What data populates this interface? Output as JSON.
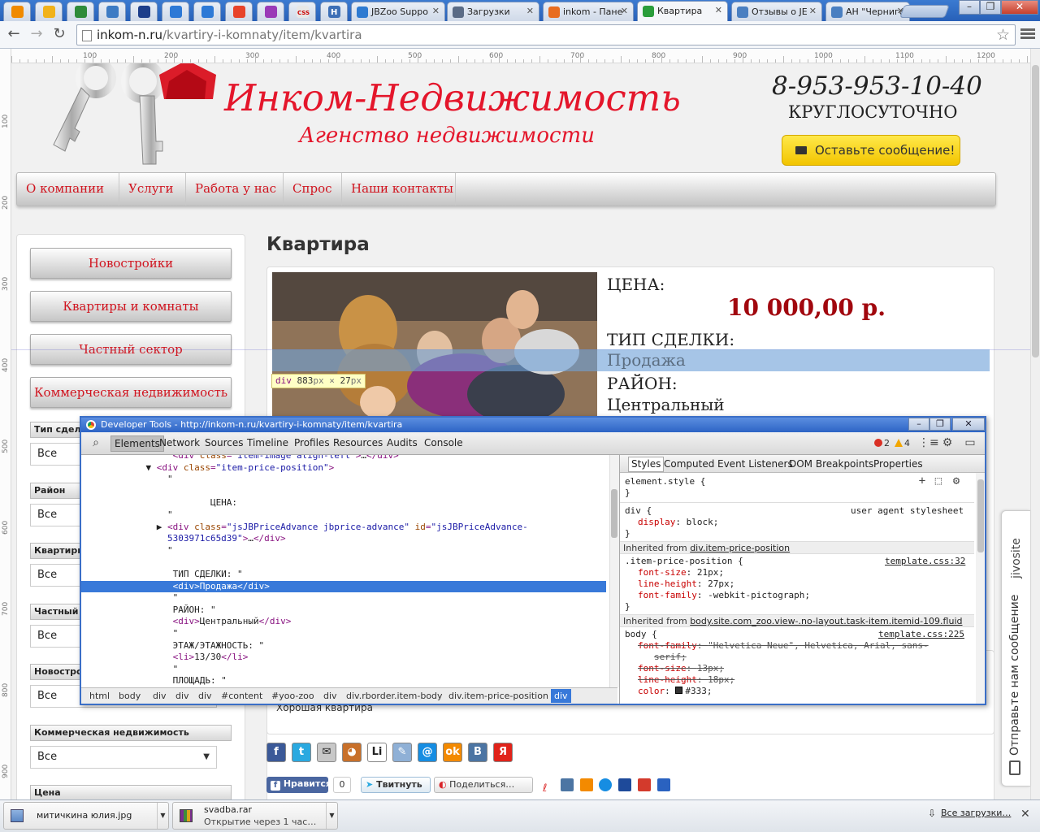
{
  "browser": {
    "tabs": [
      {
        "label": "JBZoo Suppo",
        "icon_color": "#2e7ad1"
      },
      {
        "label": "Загрузки",
        "icon_color": "#5a6b86"
      },
      {
        "label": "inkom - Пане",
        "icon_color": "#e86c1f"
      },
      {
        "label": "Квартира",
        "icon_color": "#2a9d3a"
      },
      {
        "label": "Отзывы о JE",
        "icon_color": "#4a7fc1"
      },
      {
        "label": "АН \"Черниго",
        "icon_color": "#4a7fc1"
      }
    ],
    "pinned_tabs": [
      {
        "icon": "mail-ru-icon",
        "color": "#f08a00"
      },
      {
        "icon": "dollar-icon",
        "color": "#f1b21a"
      },
      {
        "icon": "excel-icon",
        "color": "#2e8b3a"
      },
      {
        "icon": "z-icon",
        "color": "#3d7bc4"
      },
      {
        "icon": "dark-blue-icon",
        "color": "#1d3e8a"
      },
      {
        "icon": "disc-icon",
        "color": "#2d79d6"
      },
      {
        "icon": "disc-icon",
        "color": "#2d79d6"
      },
      {
        "icon": "color-wheel-icon",
        "color": "#e8432a"
      },
      {
        "icon": "flower-icon",
        "color": "#9a3ab7"
      },
      {
        "icon": "css-profi-icon",
        "color": "#e7e7e7"
      },
      {
        "icon": "h-icon",
        "color": "#3d6fb6"
      }
    ],
    "css_profi_label": "CSS",
    "h_label": "H",
    "url_host": "inkom-n.ru",
    "url_path": "/kvartiry-i-komnaty/item/kvartira",
    "window_buttons": [
      "–",
      "❐",
      "✕"
    ]
  },
  "rulers": {
    "horizontal": [
      "100",
      "200",
      "300",
      "400",
      "500",
      "600",
      "700",
      "800",
      "900",
      "1000",
      "1100",
      "1200"
    ],
    "vertical": [
      "100",
      "200",
      "300",
      "400",
      "500",
      "600",
      "700",
      "800",
      "900"
    ]
  },
  "site": {
    "title": "Инком-Недвижимость",
    "subtitle": "Агенство недвижимости",
    "phone": "8-953-953-10-40",
    "hours": "КРУГЛОСУТОЧНО",
    "message_button": "Оставьте сообщение!",
    "nav": [
      "О компании",
      "Услуги",
      "Работа у нас",
      "Спрос",
      "Наши контакты"
    ],
    "sidebar_buttons": [
      "Новостройки",
      "Квартиры и комнаты",
      "Частный сектор",
      "Коммерческая недвижимость"
    ],
    "filters": [
      {
        "label": "Тип сделки",
        "value": "Все"
      },
      {
        "label": "Район",
        "value": "Все"
      },
      {
        "label": "Квартиры",
        "value": "Все"
      },
      {
        "label": "Частный с",
        "value": "Все"
      },
      {
        "label": "Новострои",
        "value": "Все"
      },
      {
        "label": "Коммерческая недвижимость",
        "value": "Все"
      },
      {
        "label": "Цена",
        "value": ""
      }
    ],
    "page_heading": "Квартира",
    "price_label": "ЦЕНА:",
    "price_value": "10 000,00 р.",
    "deal_label": "ТИП СДЕЛКИ:",
    "deal_value": "Продажа",
    "district_label": "РАЙОН:",
    "district_value": "Центральный",
    "description": "Хорошая квартира",
    "share_icons": [
      {
        "name": "facebook-share-icon",
        "color": "#3b5998",
        "glyph": "f"
      },
      {
        "name": "twitter-share-icon",
        "color": "#2aa9e0",
        "glyph": "t"
      },
      {
        "name": "email-share-icon",
        "color": "#c8c8c8",
        "glyph": "✉"
      },
      {
        "name": "dog-share-icon",
        "color": "#c8702a",
        "glyph": "◕"
      },
      {
        "name": "liveinternet-share-icon",
        "color": "#ffffff",
        "glyph": "Li"
      },
      {
        "name": "pencil-share-icon",
        "color": "#8fb0d6",
        "glyph": "✎"
      },
      {
        "name": "mailru-share-icon",
        "color": "#168de2",
        "glyph": "@"
      },
      {
        "name": "odnoklassniki-share-icon",
        "color": "#f38a00",
        "glyph": "ok"
      },
      {
        "name": "vkontakte-share-icon",
        "color": "#4c75a3",
        "glyph": "B"
      },
      {
        "name": "yandex-share-icon",
        "color": "#e0231a",
        "glyph": "Я"
      }
    ],
    "like_label": "Нравится",
    "like_count": "0",
    "tweet_label": "Твитнуть",
    "share_label": "Поделиться…"
  },
  "inspector": {
    "tag": "div",
    "width": "883",
    "height": "27",
    "unit": "px",
    "sep": "×"
  },
  "jivosite": {
    "brand": "jivosite",
    "text": "Отправьте нам сообщение"
  },
  "devtools": {
    "title": "Developer Tools - http://inkom-n.ru/kvartiry-i-komnaty/item/kvartira",
    "tabs": [
      "Elements",
      "Network",
      "Sources",
      "Timeline",
      "Profiles",
      "Resources",
      "Audits",
      "Console"
    ],
    "active_tab": "Elements",
    "errors": "2",
    "warnings": "4",
    "dom_lines": [
      [
        {
          "t": "tx",
          "s": "                 "
        },
        {
          "t": "tg",
          "s": "<div "
        },
        {
          "t": "an",
          "s": "class"
        },
        {
          "t": "tg",
          "s": "="
        },
        {
          "t": "av",
          "s": "\"item-image align-left\""
        },
        {
          "t": "tg",
          "s": ">"
        },
        {
          "t": "tx",
          "s": "…"
        },
        {
          "t": "tg",
          "s": "</div>"
        }
      ],
      [
        {
          "t": "tx",
          "s": "            ▼ "
        },
        {
          "t": "tg",
          "s": "<div "
        },
        {
          "t": "an",
          "s": "class"
        },
        {
          "t": "tg",
          "s": "="
        },
        {
          "t": "av",
          "s": "\"item-price-position\""
        },
        {
          "t": "tg",
          "s": ">"
        }
      ],
      [
        {
          "t": "tx",
          "s": "                \""
        }
      ],
      [
        {
          "t": "tx",
          "s": ""
        }
      ],
      [
        {
          "t": "tx",
          "s": "                        ЦЕНА:"
        }
      ],
      [
        {
          "t": "tx",
          "s": "                \""
        }
      ],
      [
        {
          "t": "tx",
          "s": "              ▶ "
        },
        {
          "t": "tg",
          "s": "<div "
        },
        {
          "t": "an",
          "s": "class"
        },
        {
          "t": "tg",
          "s": "="
        },
        {
          "t": "av",
          "s": "\"jsJBPriceAdvance jbprice-advance\""
        },
        {
          "t": "tx",
          "s": " "
        },
        {
          "t": "an",
          "s": "id"
        },
        {
          "t": "tg",
          "s": "="
        },
        {
          "t": "av",
          "s": "\"jsJBPriceAdvance-"
        }
      ],
      [
        {
          "t": "av",
          "s": "                5303971c65d39\""
        },
        {
          "t": "tg",
          "s": ">"
        },
        {
          "t": "tx",
          "s": "…"
        },
        {
          "t": "tg",
          "s": "</div>"
        }
      ],
      [
        {
          "t": "tx",
          "s": "                \""
        }
      ],
      [
        {
          "t": "tx",
          "s": ""
        }
      ],
      [
        {
          "t": "tx",
          "s": "                 ТИП СДЕЛКИ: \""
        }
      ],
      [
        {
          "t": "tx",
          "s": "                 "
        },
        {
          "t": "tg",
          "s": "<div>"
        },
        {
          "t": "tx",
          "s": "Продажа"
        },
        {
          "t": "tg",
          "s": "</div>"
        }
      ],
      [
        {
          "t": "tx",
          "s": "                 \""
        }
      ],
      [
        {
          "t": "tx",
          "s": "                 РАЙОН: \""
        }
      ],
      [
        {
          "t": "tx",
          "s": "                 "
        },
        {
          "t": "tg",
          "s": "<div>"
        },
        {
          "t": "tx",
          "s": "Центральный"
        },
        {
          "t": "tg",
          "s": "</div>"
        }
      ],
      [
        {
          "t": "tx",
          "s": "                 \""
        }
      ],
      [
        {
          "t": "tx",
          "s": "                 ЭТАЖ/ЭТАЖНОСТЬ: \""
        }
      ],
      [
        {
          "t": "tx",
          "s": "                 "
        },
        {
          "t": "tg",
          "s": "<li>"
        },
        {
          "t": "tx",
          "s": "13/30"
        },
        {
          "t": "tg",
          "s": "</li>"
        }
      ],
      [
        {
          "t": "tx",
          "s": "                 \""
        }
      ],
      [
        {
          "t": "tx",
          "s": "                 ПЛОЩАДЬ: \""
        }
      ],
      [
        {
          "t": "tx",
          "s": "                 "
        },
        {
          "t": "tg",
          "s": "<li>"
        },
        {
          "t": "tx",
          "s": "50 кв метров."
        },
        {
          "t": "tg",
          "s": "</li>"
        }
      ]
    ],
    "selected_line": 11,
    "crumbs": [
      "html",
      "body",
      "div",
      "div",
      "div",
      "#content",
      "#yoo-zoo",
      "div",
      "div.rborder.item-body",
      "div.item-price-position",
      "div"
    ],
    "styles_tabs": [
      "Styles",
      "Computed",
      "Event Listeners",
      "DOM Breakpoints",
      "Properties"
    ],
    "styles": {
      "element_style": "element.style {",
      "close": "}",
      "ua_selector": "div {",
      "ua_source": "user agent stylesheet",
      "ua_prop": "display",
      "ua_val": "block;",
      "inh1_prefix": "Inherited from ",
      "inh1_link": "div.item-price-position",
      "rule1_selector": ".item-price-position {",
      "rule1_source": "template.css:32",
      "rule1_props": [
        {
          "p": "font-size",
          "v": "21px;"
        },
        {
          "p": "line-height",
          "v": "27px;"
        },
        {
          "p": "font-family",
          "v": "-webkit-pictograph;"
        }
      ],
      "inh2_prefix": "Inherited from ",
      "inh2_link": "body.site.com_zoo.view-.no-layout.task-item.itemid-109.fluid",
      "rule2_selector": "body {",
      "rule2_source": "template.css:225",
      "rule2_props": [
        {
          "p": "font-family",
          "v": "\"Helvetica Neue\", Helvetica, Arial, sans-"
        },
        {
          "p": "",
          "v": "serif;"
        },
        {
          "p": "font-size",
          "v": "13px;"
        },
        {
          "p": "line-height",
          "v": "18px;"
        },
        {
          "p": "color",
          "v": "#333;"
        }
      ]
    }
  },
  "downloads": [
    {
      "name": "митичкина юлия.jpg",
      "status": ""
    },
    {
      "name": "svadba.rar",
      "status": "Открытие через 1 час…"
    }
  ],
  "downloads_all": "Все загрузки…",
  "downloads_close": "✕",
  "colors": {
    "brand_red": "#e4162b",
    "price_red": "#a1070e",
    "nav_red": "#d0141f",
    "yellow_button": "#f2c400",
    "highlight": "#6fa1d9",
    "devtools_select": "#3879d9"
  }
}
